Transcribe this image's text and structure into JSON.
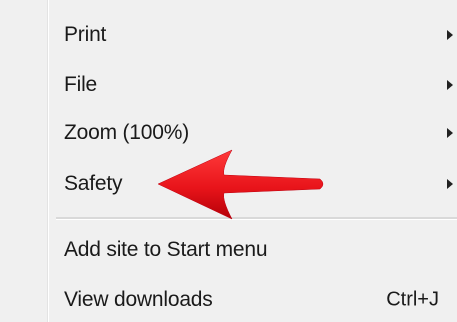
{
  "menu": {
    "items": [
      {
        "label": "Print",
        "has_submenu": true
      },
      {
        "label": "File",
        "has_submenu": true
      },
      {
        "label": "Zoom (100%)",
        "has_submenu": true
      },
      {
        "label": "Safety",
        "has_submenu": true
      },
      {
        "label": "Add site to Start menu",
        "has_submenu": false
      },
      {
        "label": "View downloads",
        "has_submenu": false,
        "shortcut": "Ctrl+J"
      }
    ]
  },
  "annotation": {
    "arrow_color": "#e8141a",
    "icon": "red-pointer-arrow-icon"
  }
}
